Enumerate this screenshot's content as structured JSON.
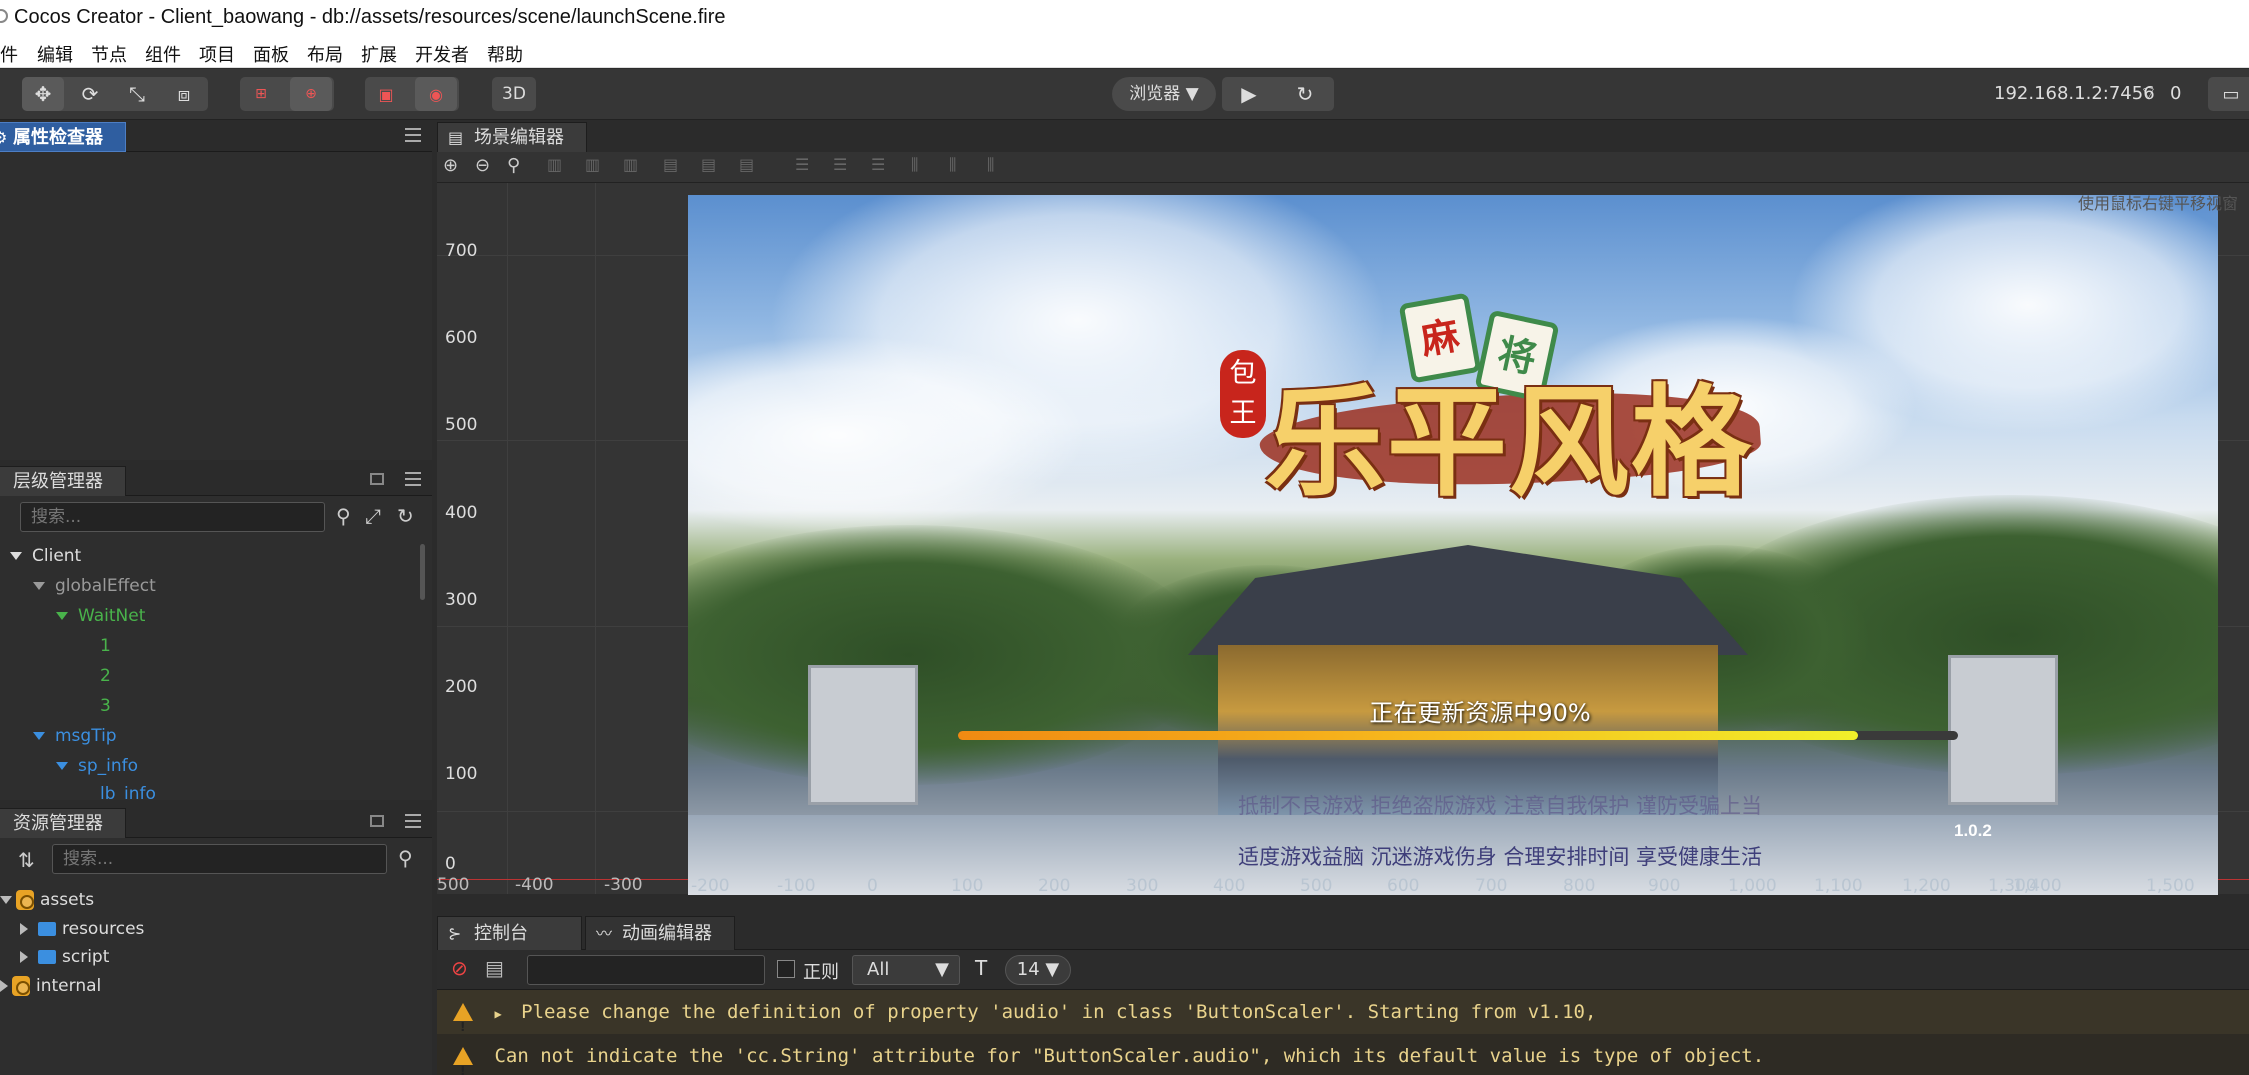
{
  "window": {
    "title": "Cocos Creator - Client_baowang - db://assets/resources/scene/launchScene.fire"
  },
  "menubar": {
    "items": [
      "件",
      "编辑",
      "节点",
      "组件",
      "项目",
      "面板",
      "布局",
      "扩展",
      "开发者",
      "帮助"
    ]
  },
  "toolbar": {
    "mode_3d_label": "3D",
    "preview_platform_label": "浏览器 ▼",
    "ip_address": "192.168.1.2:7456",
    "connected_count": "0"
  },
  "inspector": {
    "tab_label": "属性检查器"
  },
  "hierarchy": {
    "tab_label": "层级管理器",
    "search_placeholder": "搜索...",
    "nodes": [
      {
        "label": "Client",
        "color": "#dddddd"
      },
      {
        "label": "globalEffect",
        "color": "#9a9a9a"
      },
      {
        "label": "WaitNet",
        "color": "#49b34b"
      },
      {
        "label": "1",
        "color": "#49b34b"
      },
      {
        "label": "2",
        "color": "#49b34b"
      },
      {
        "label": "3",
        "color": "#49b34b"
      },
      {
        "label": "msgTip",
        "color": "#3b8fe0"
      },
      {
        "label": "sp_info",
        "color": "#3b8fe0"
      },
      {
        "label": "lb_info",
        "color": "#3b8fe0"
      }
    ]
  },
  "assets": {
    "tab_label": "资源管理器",
    "search_placeholder": "搜索...",
    "items": [
      {
        "label": "assets"
      },
      {
        "label": "resources"
      },
      {
        "label": "script"
      },
      {
        "label": "internal"
      }
    ]
  },
  "scene_editor": {
    "tab_label": "场景编辑器",
    "hint_text": "使用鼠标右键平移视窗",
    "y_ticks": [
      "700",
      "600",
      "500",
      "400",
      "300",
      "200",
      "100",
      "0"
    ],
    "x_ticks": [
      "500",
      "-400",
      "-300",
      "-200",
      "-100",
      "0",
      "100",
      "200",
      "300",
      "400",
      "500",
      "600",
      "700",
      "800",
      "900",
      "1,000",
      "1,100",
      "1,200",
      "1,300",
      "1,400",
      "1,500"
    ]
  },
  "game": {
    "seal_text": "包王",
    "tile_left": "麻",
    "tile_right": "将",
    "title_text": "乐平风格",
    "update_status": "正在更新资源中90%",
    "progress": 0.9,
    "version": "1.0.2",
    "health_notice_line1": "抵制不良游戏  拒绝盗版游戏  注意自我保护  谨防受骗上当",
    "health_notice_line2": "适度游戏益脑  沉迷游戏伤身  合理安排时间  享受健康生活"
  },
  "console": {
    "tab_label": "控制台",
    "anim_tab_label": "动画编辑器",
    "regex_label": "正则",
    "level_select": "All",
    "font_size": "14 ▼",
    "logs": [
      {
        "text": "Please change the definition of property 'audio' in class 'ButtonScaler'. Starting from v1.10,"
      },
      {
        "text": "Can not indicate the 'cc.String' attribute for \"ButtonScaler.audio\", which its default value is type of object."
      }
    ]
  },
  "colors": {
    "accent_blue": "#2f5ea0",
    "warning": "#e8a325",
    "log_text": "#e9d38c"
  }
}
